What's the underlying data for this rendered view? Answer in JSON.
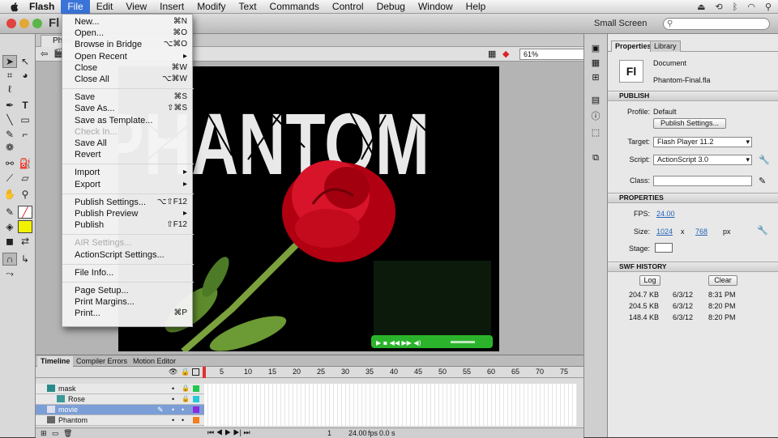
{
  "menubar": {
    "apple": "",
    "app": "Flash",
    "items": [
      "File",
      "Edit",
      "View",
      "Insert",
      "Modify",
      "Text",
      "Commands",
      "Control",
      "Debug",
      "Window",
      "Help"
    ]
  },
  "window": {
    "app_badge": "Fl",
    "workspace": "Small Screen",
    "search_placeholder": "",
    "zoom": "61%",
    "doc_tab": "Phan"
  },
  "file_menu": [
    {
      "label": "New...",
      "shortcut": "⌘N",
      "sub": false,
      "disabled": false
    },
    {
      "label": "Open...",
      "shortcut": "⌘O",
      "sub": false,
      "disabled": false
    },
    {
      "label": "Browse in Bridge",
      "shortcut": "⌥⌘O",
      "sub": false,
      "disabled": false
    },
    {
      "label": "Open Recent",
      "shortcut": "▸",
      "sub": true,
      "disabled": false
    },
    {
      "label": "Close",
      "shortcut": "⌘W",
      "sub": false,
      "disabled": false
    },
    {
      "label": "Close All",
      "shortcut": "⌥⌘W",
      "sub": false,
      "disabled": false
    },
    {
      "sep": true
    },
    {
      "label": "Save",
      "shortcut": "⌘S",
      "sub": false,
      "disabled": false
    },
    {
      "label": "Save As...",
      "shortcut": "⇧⌘S",
      "sub": false,
      "disabled": false
    },
    {
      "label": "Save as Template...",
      "shortcut": "",
      "sub": false,
      "disabled": false
    },
    {
      "label": "Check In...",
      "shortcut": "",
      "sub": false,
      "disabled": true
    },
    {
      "label": "Save All",
      "shortcut": "",
      "sub": false,
      "disabled": false
    },
    {
      "label": "Revert",
      "shortcut": "",
      "sub": false,
      "disabled": false
    },
    {
      "sep": true
    },
    {
      "label": "Import",
      "shortcut": "▸",
      "sub": true,
      "disabled": false
    },
    {
      "label": "Export",
      "shortcut": "▸",
      "sub": true,
      "disabled": false
    },
    {
      "sep": true
    },
    {
      "label": "Publish Settings...",
      "shortcut": "⌥⇧F12",
      "sub": false,
      "disabled": false
    },
    {
      "label": "Publish Preview",
      "shortcut": "▸",
      "sub": true,
      "disabled": false
    },
    {
      "label": "Publish",
      "shortcut": "⇧F12",
      "sub": false,
      "disabled": false
    },
    {
      "sep": true
    },
    {
      "label": "AIR Settings...",
      "shortcut": "",
      "sub": false,
      "disabled": true
    },
    {
      "label": "ActionScript Settings...",
      "shortcut": "",
      "sub": false,
      "disabled": false
    },
    {
      "sep": true
    },
    {
      "label": "File Info...",
      "shortcut": "",
      "sub": false,
      "disabled": false
    },
    {
      "sep": true
    },
    {
      "label": "Page Setup...",
      "shortcut": "",
      "sub": false,
      "disabled": false
    },
    {
      "label": "Print Margins...",
      "shortcut": "",
      "sub": false,
      "disabled": false
    },
    {
      "label": "Print...",
      "shortcut": "⌘P",
      "sub": false,
      "disabled": false
    }
  ],
  "stage": {
    "title": "PHANTOM"
  },
  "properties": {
    "tabs": [
      "Properties",
      "Library"
    ],
    "doc_icon": "Fl",
    "doc_type": "Document",
    "doc_name": "Phantom-Final.fla",
    "publish": {
      "header": "PUBLISH",
      "profile_label": "Profile:",
      "profile": "Default",
      "settings_button": "Publish Settings...",
      "target_label": "Target:",
      "target": "Flash Player 11.2",
      "script_label": "Script:",
      "script": "ActionScript 3.0",
      "class_label": "Class:",
      "class_value": ""
    },
    "props": {
      "header": "PROPERTIES",
      "fps_label": "FPS:",
      "fps": "24.00",
      "size_label": "Size:",
      "width": "1024",
      "x": "x",
      "height": "768",
      "unit": "px",
      "stage_label": "Stage:",
      "stage_color": "#ffffff"
    },
    "history": {
      "header": "SWF HISTORY",
      "log": "Log",
      "clear": "Clear",
      "rows": [
        [
          "204.7 KB",
          "6/3/12",
          "8:31 PM"
        ],
        [
          "204.5 KB",
          "6/3/12",
          "8:20 PM"
        ],
        [
          "148.4 KB",
          "6/3/12",
          "8:20 PM"
        ]
      ]
    }
  },
  "timeline": {
    "tabs": [
      "Timeline",
      "Compiler Errors",
      "Motion Editor"
    ],
    "frame_numbers": [
      "5",
      "10",
      "15",
      "20",
      "25",
      "30",
      "35",
      "40",
      "45",
      "50",
      "55",
      "60",
      "65",
      "70",
      "75"
    ],
    "layers": [
      {
        "name": "mask",
        "color": "#22c84c",
        "selected": false,
        "indent": false
      },
      {
        "name": "Rose",
        "color": "#29c9d8",
        "selected": false,
        "indent": true
      },
      {
        "name": "movie",
        "color": "#8a2be2",
        "selected": true,
        "indent": false
      },
      {
        "name": "Phantom",
        "color": "#f08020",
        "selected": false,
        "indent": false
      }
    ],
    "status": {
      "frame": "1",
      "fps": "24.00",
      "fps_unit": "fps",
      "time": "0.0 s"
    }
  }
}
